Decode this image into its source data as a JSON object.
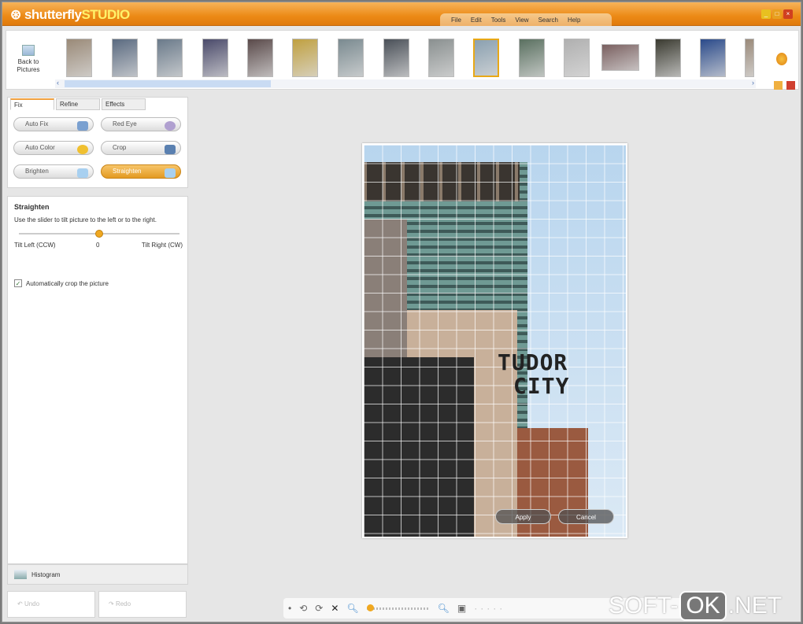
{
  "app": {
    "logo_main": "shutterfly",
    "logo_sub": "STUDIO"
  },
  "menu": [
    "File",
    "Edit",
    "Tools",
    "View",
    "Search",
    "Help"
  ],
  "filmstrip": {
    "back_label": "Back to Pictures",
    "thumb_count": 16,
    "selected_index": 9
  },
  "tabs": [
    "Fix",
    "Refine",
    "Effects"
  ],
  "fix_buttons": [
    "Auto Fix",
    "Red Eye",
    "Auto Color",
    "Crop",
    "Brighten",
    "Straighten"
  ],
  "straighten": {
    "title": "Straighten",
    "description": "Use the slider to tilt picture to the left or to the right.",
    "left_label": "Tilt Left (CCW)",
    "value": "0",
    "right_label": "Tilt Right (CW)",
    "auto_crop_label": "Automatically crop the picture",
    "auto_crop_checked": true
  },
  "histogram_label": "Histogram",
  "undo_label": "Undo",
  "redo_label": "Redo",
  "photo": {
    "sign_line1": "TUDOR",
    "sign_line2": "CITY",
    "apply": "Apply",
    "cancel": "Cancel"
  },
  "watermark": {
    "left": "SOFT-",
    "mid": "OK",
    "right": ".NET"
  },
  "colors": {
    "accent": "#ec8a16",
    "selected": "#e8a817"
  }
}
